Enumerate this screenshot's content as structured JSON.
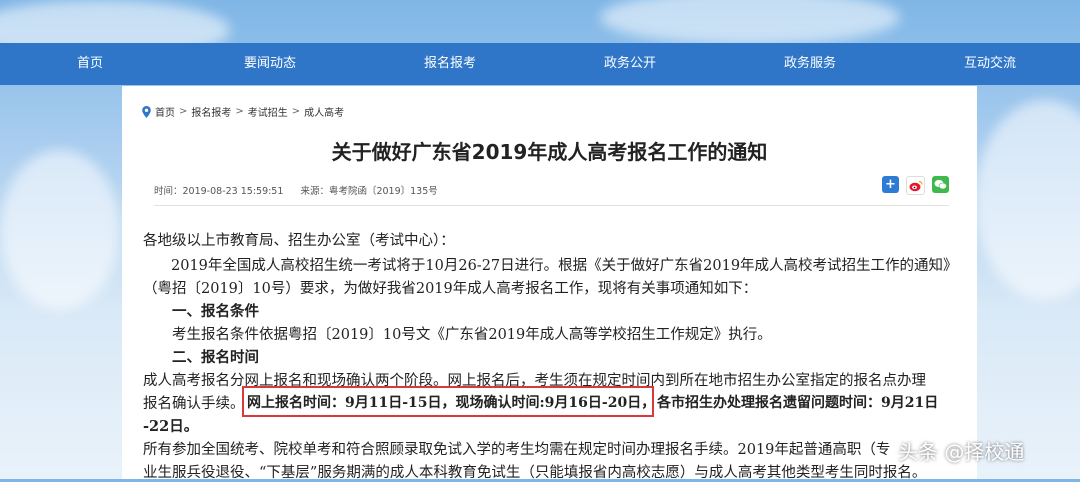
{
  "nav": [
    "首页",
    "要闻动态",
    "报名报考",
    "政务公开",
    "政务服务",
    "互动交流"
  ],
  "breadcrumb": [
    "首页",
    "报名报考",
    "考试招生",
    "成人高考"
  ],
  "breadcrumb_sep": ">",
  "article": {
    "title": "关于做好广东省2019年成人高考报名工作的通知",
    "time": "时间：2019-08-23 15:59:51",
    "source": "来源：粤考院函〔2019〕135号",
    "lines": [
      "各地级以上市教育局、招生办公室（考试中心）：",
      "2019年全国成人高校招生统一考试将于10月26-27日进行。根据《关于做好广东省2019年成人高校考试招生工作的通知》",
      "（粤招〔2019〕10号）要求，为做好我省2019年成人高考报名工作，现将有关事项通知如下：",
      "一、报名条件",
      "考生报名条件依据粤招〔2019〕10号文《广东省2019年成人高等学校招生工作规定》执行。",
      "二、报名时间",
      "成人高考报名分网上报名和现场确认两个阶段。网上报名后，考生须在规定时间内到所在地市招生办公室指定的报名点办理",
      "报名确认手续。",
      "网上报名时间：9月11日-15日，现场确认时间:9月16日-20日，",
      "各市招生办处理报名遗留问题时间：9月21日",
      "-22日。",
      "所有参加全国统考、院校单考和符合照顾录取免试入学的考生均需在规定时间办理报名手续。2019年起普通高职（专",
      "业生服兵役退役、“下基层”服务期满的成人本科教育免试生（只能填报省内高校志愿）与成人高考其他类型考生同时报名。"
    ]
  },
  "watermark": "头条 @择校通"
}
